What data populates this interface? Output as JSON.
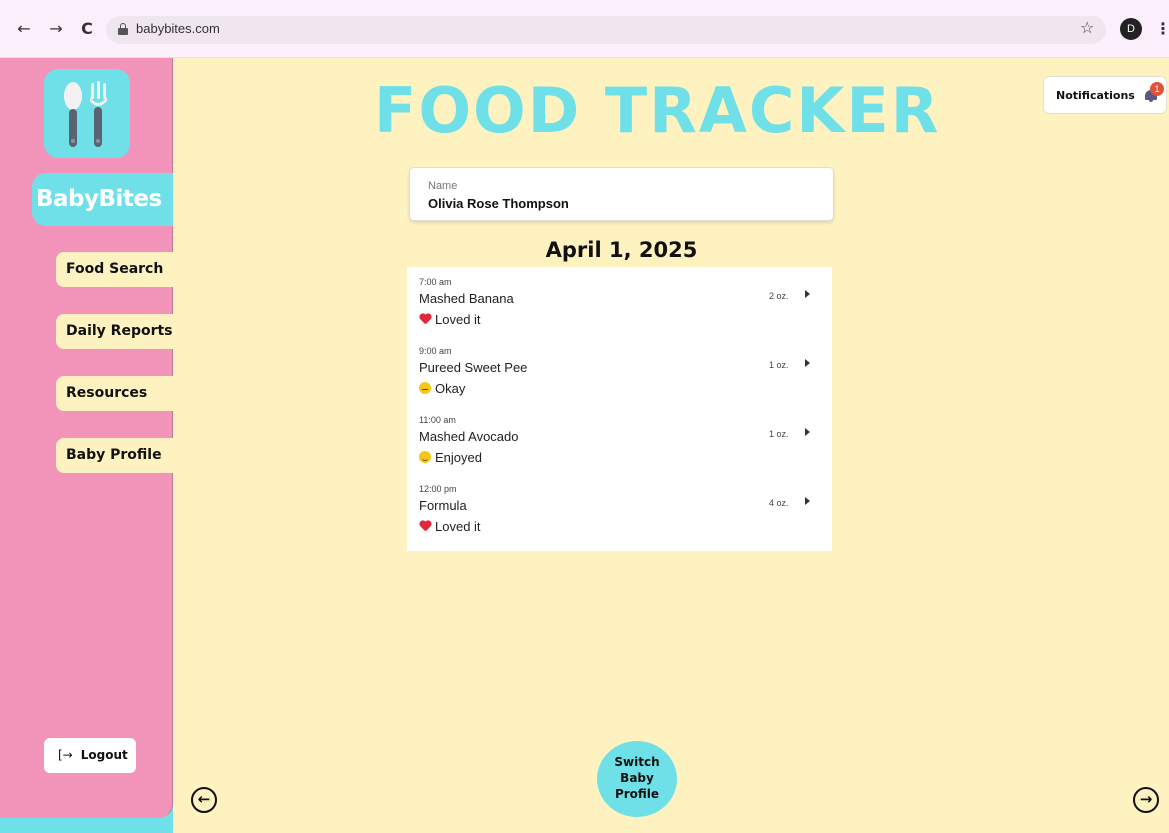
{
  "browser": {
    "back_icon": "←",
    "forward_icon": "→",
    "reload_icon": "C",
    "url": "babybites.com",
    "bookmark_icon": "☆",
    "profile_initial": "D",
    "menu_icon": "⋮"
  },
  "sidebar": {
    "brand": "BabyBites",
    "items": [
      {
        "label": "Food Search"
      },
      {
        "label": "Daily Reports"
      },
      {
        "label": "Resources"
      },
      {
        "label": "Baby Profile"
      }
    ],
    "logout_icon": "[→",
    "logout_label": "Logout"
  },
  "header": {
    "title": "FOOD TRACKER",
    "notifications_label": "Notifications",
    "notifications_count": "1"
  },
  "profile": {
    "name_label": "Name",
    "name_value": "Olivia Rose Thompson"
  },
  "log": {
    "date": "April 1, 2025",
    "entries": [
      {
        "time": "7:00 am",
        "food": "Mashed Banana",
        "reaction": "Loved it",
        "amount": "2 oz."
      },
      {
        "time": "9:00 am",
        "food": "Pureed Sweet Pee",
        "reaction": "Okay",
        "amount": "1 oz."
      },
      {
        "time": "11:00 am",
        "food": "Mashed Avocado",
        "reaction": "Enjoyed",
        "amount": "1 oz."
      },
      {
        "time": "12:00 pm",
        "food": "Formula",
        "reaction": "Loved it",
        "amount": "4 oz."
      }
    ]
  },
  "footer": {
    "switch_line1": "Switch",
    "switch_line2": "Baby",
    "switch_line3": "Profile",
    "prev_icon": "←",
    "next_icon": "→"
  },
  "colors": {
    "background": "#fef3c0",
    "sidebar": "#f294ba",
    "accent": "#6fe0e8",
    "heart": "#e0283a",
    "badge": "#e0533a"
  }
}
